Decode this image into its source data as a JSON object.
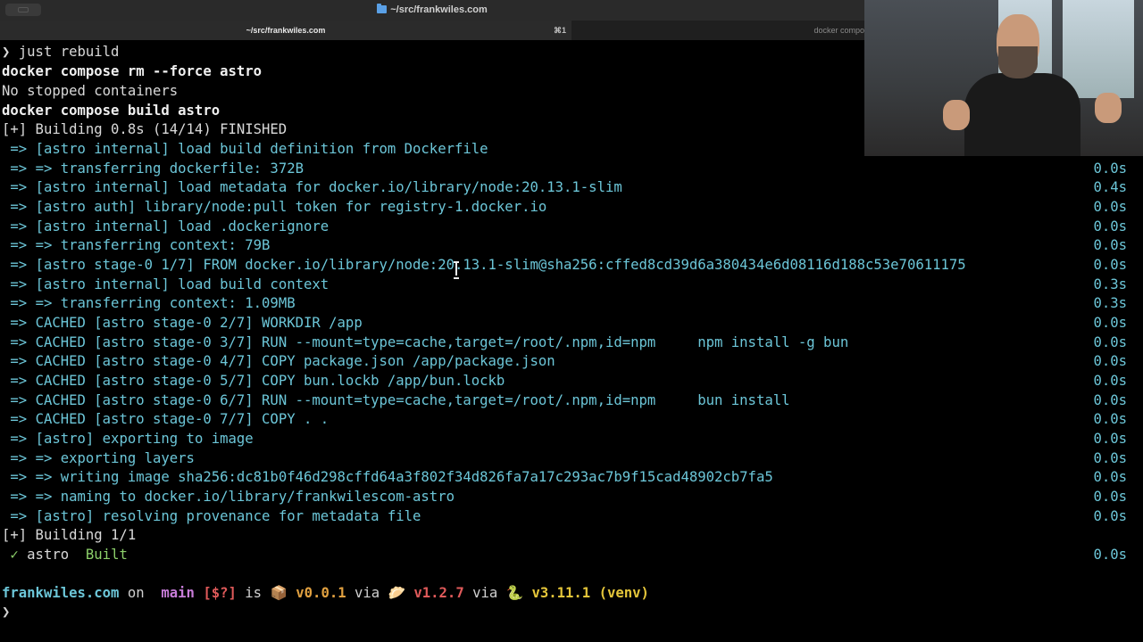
{
  "window": {
    "title": "~/src/frankwiles.com"
  },
  "tabs": [
    {
      "label": "~/src/frankwiles.com",
      "shortcut": "⌘1"
    },
    {
      "label": "docker compo"
    }
  ],
  "terminal": {
    "lines": [
      {
        "text": "❯ just rebuild"
      },
      {
        "text": "docker compose rm --force astro"
      },
      {
        "text": "No stopped containers"
      },
      {
        "text": "docker compose build astro"
      },
      {
        "text": "[+] Building 0.8s (14/14) FINISHED"
      },
      {
        "arrow": " =>",
        "text": "[astro internal] load build definition from Dockerfile",
        "time": ""
      },
      {
        "arrow": " =>",
        "text": "=> transferring dockerfile: 372B",
        "time": "0.0s"
      },
      {
        "arrow": " =>",
        "text": "[astro internal] load metadata for docker.io/library/node:20.13.1-slim",
        "time": "0.4s"
      },
      {
        "arrow": " =>",
        "text": "[astro auth] library/node:pull token for registry-1.docker.io",
        "time": "0.0s"
      },
      {
        "arrow": " =>",
        "text": "[astro internal] load .dockerignore",
        "time": "0.0s"
      },
      {
        "arrow": " =>",
        "text": "=> transferring context: 79B",
        "time": "0.0s"
      },
      {
        "arrow": " =>",
        "text": "[astro stage-0 1/7] FROM docker.io/library/node:20.13.1-slim@sha256:cffed8cd39d6a380434e6d08116d188c53e70611175",
        "time": "0.0s"
      },
      {
        "arrow": " =>",
        "text": "[astro internal] load build context",
        "time": "0.3s"
      },
      {
        "arrow": " =>",
        "text": "=> transferring context: 1.09MB",
        "time": "0.3s"
      },
      {
        "arrow": " =>",
        "text": "CACHED [astro stage-0 2/7] WORKDIR /app",
        "time": "0.0s"
      },
      {
        "arrow": " =>",
        "text": "CACHED [astro stage-0 3/7] RUN --mount=type=cache,target=/root/.npm,id=npm     npm install -g bun",
        "time": "0.0s"
      },
      {
        "arrow": " =>",
        "text": "CACHED [astro stage-0 4/7] COPY package.json /app/package.json",
        "time": "0.0s"
      },
      {
        "arrow": " =>",
        "text": "CACHED [astro stage-0 5/7] COPY bun.lockb /app/bun.lockb",
        "time": "0.0s"
      },
      {
        "arrow": " =>",
        "text": "CACHED [astro stage-0 6/7] RUN --mount=type=cache,target=/root/.npm,id=npm     bun install",
        "time": "0.0s"
      },
      {
        "arrow": " =>",
        "text": "CACHED [astro stage-0 7/7] COPY . .",
        "time": "0.0s"
      },
      {
        "arrow": " =>",
        "text": "[astro] exporting to image",
        "time": "0.0s"
      },
      {
        "arrow": " =>",
        "text": "=> exporting layers",
        "time": "0.0s"
      },
      {
        "arrow": " =>",
        "text": "=> writing image sha256:dc81b0f46d298cffd64a3f802f34d826fa7a17c293ac7b9f15cad48902cb7fa5",
        "time": "0.0s"
      },
      {
        "arrow": " =>",
        "text": "=> naming to docker.io/library/frankwilescom-astro",
        "time": "0.0s"
      },
      {
        "arrow": " =>",
        "text": "[astro] resolving provenance for metadata file",
        "time": "0.0s"
      },
      {
        "text": "[+] Building 1/1"
      },
      {
        "check": " ✓",
        "name": "astro",
        "status": "Built",
        "time": "0.0s"
      }
    ],
    "prompt": {
      "dir": "frankwiles.com",
      "on": " on ",
      "branch_icon": "",
      "branch": " main",
      "status": " [$?]",
      "is": " is ",
      "package_icon": "📦",
      "version": " v0.0.1",
      "via1": " via ",
      "bun_icon": "🥟",
      "bun_version": " v1.2.7",
      "via2": " via ",
      "py_icon": "🐍",
      "py_version": " v3.11.1 (venv)"
    },
    "cursor_prompt": "❯"
  },
  "webcam": {
    "description_icon": "webcam-presenter"
  }
}
